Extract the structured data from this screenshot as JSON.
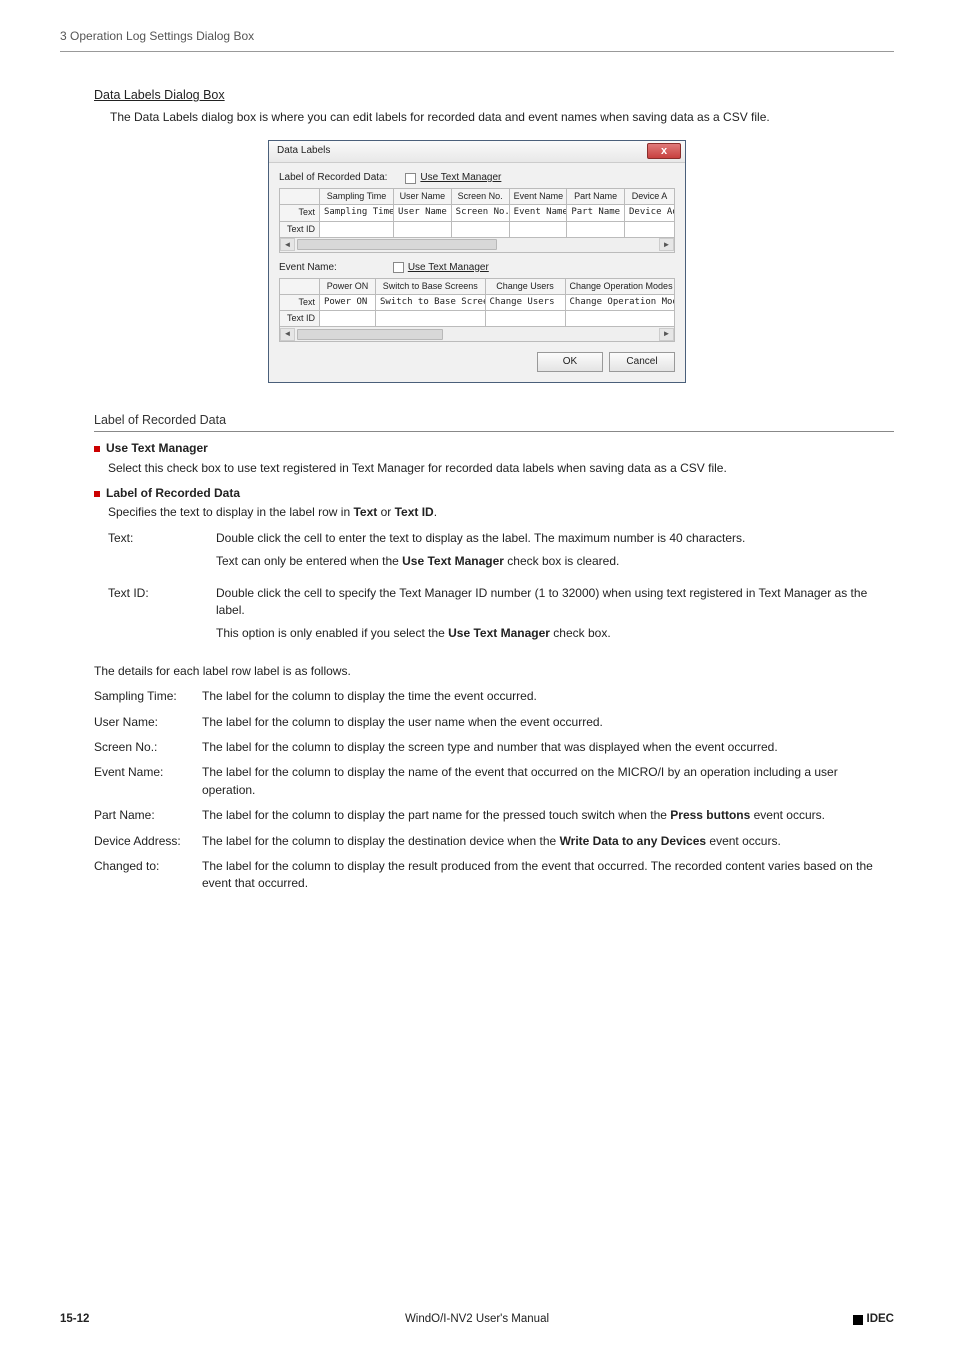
{
  "header": "3 Operation Log Settings Dialog Box",
  "section_title": "Data Labels Dialog Box",
  "intro": "The Data Labels dialog box is where you can edit labels for recorded data and event names when saving data as a CSV file.",
  "dialog": {
    "title": "Data Labels",
    "close": "x",
    "group1_label": "Label of Recorded Data:",
    "use_text_manager1": "Use Text Manager",
    "table1": {
      "headers": [
        "",
        "Sampling Time",
        "User Name",
        "Screen No.",
        "Event Name",
        "Part Name",
        "Device A"
      ],
      "row_text_label": "Text",
      "row_text": [
        "Sampling Time",
        "User Name",
        "Screen No.",
        "Event Name",
        "Part Name",
        "Device Ad"
      ],
      "row_id_label": "Text ID",
      "row_id": [
        "",
        "",
        "",
        "",
        "",
        ""
      ]
    },
    "group2_label": "Event Name:",
    "use_text_manager2": "Use Text Manager",
    "table2": {
      "headers": [
        "",
        "Power ON",
        "Switch to Base Screens",
        "Change Users",
        "Change Operation Modes"
      ],
      "row_text_label": "Text",
      "row_text": [
        "Power ON",
        "Switch to Base Screens",
        "Change Users",
        "Change Operation Modes"
      ],
      "row_id_label": "Text ID",
      "row_id": [
        "",
        "",
        "",
        ""
      ]
    },
    "ok": "OK",
    "cancel": "Cancel"
  },
  "sub_heading": "Label of Recorded Data",
  "bullets": {
    "useTextManager": {
      "title": "Use Text Manager",
      "body": "Select this check box to use text registered in Text Manager for recorded data labels when saving data as a CSV file."
    },
    "labelRecorded": {
      "title": "Label of Recorded Data",
      "body_pre": "Specifies the text to display in the label row in ",
      "body_b1": "Text",
      "body_mid": " or ",
      "body_b2": "Text ID",
      "body_post": "."
    }
  },
  "defs1": {
    "text": {
      "term": "Text:",
      "p1": "Double click the cell to enter the text to display as the label. The maximum number is 40 characters.",
      "p2a": "Text can only be entered when the ",
      "p2b": "Use Text Manager",
      "p2c": " check box is cleared."
    },
    "textid": {
      "term": "Text ID:",
      "p1": "Double click the cell to specify the Text Manager ID number (1 to 32000) when using text registered in Text Manager as the label.",
      "p2a": "This option is only enabled if you select the ",
      "p2b": "Use Text Manager",
      "p2c": " check box."
    }
  },
  "details_intro": "The details for each label row label is as follows.",
  "defs2": {
    "sampling": {
      "term": "Sampling Time:",
      "body": "The label for the column to display the time the event occurred."
    },
    "user": {
      "term": "User Name:",
      "body": "The label for the column to display the user name when the event occurred."
    },
    "screen": {
      "term": "Screen No.:",
      "body": "The label for the column to display the screen type and number that was displayed when the event occurred."
    },
    "event": {
      "term": "Event Name:",
      "body": "The label for the column to display the name of the event that occurred on the MICRO/I by an operation including a user operation."
    },
    "part": {
      "term": "Part Name:",
      "pre": "The label for the column to display the part name for the pressed touch switch when the ",
      "b": "Press buttons",
      "post": " event occurs."
    },
    "device": {
      "term": "Device Address:",
      "pre": "The label for the column to display the destination device when the ",
      "b": "Write Data to any Devices",
      "post": " event occurs."
    },
    "changed": {
      "term": "Changed to:",
      "body": "The label for the column to display the result produced from the event that occurred. The recorded content varies based on the event that occurred."
    }
  },
  "footer": {
    "page": "15-12",
    "center": "WindO/I-NV2 User's Manual",
    "brand": "IDEC"
  }
}
